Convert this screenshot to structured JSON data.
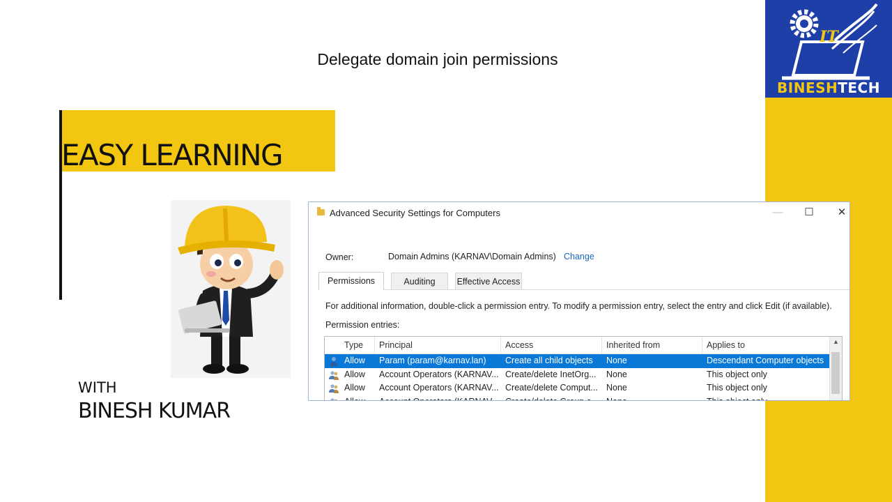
{
  "page_title": "Delegate domain join permissions",
  "banner_text": "EASY LEARNING",
  "with_label": "WITH",
  "author": "BINESH KUMAR",
  "logo": {
    "badge": "IT",
    "part1": "BINESH",
    "part2": "TECH"
  },
  "colors": {
    "accent_yellow": "#f2c611",
    "logo_blue": "#1f3fa8",
    "selection_blue": "#0a78d7",
    "link_blue": "#1a63c6"
  },
  "dialog": {
    "title": "Advanced Security Settings for Computers",
    "window_buttons": {
      "minimize": "—",
      "maximize": "☐",
      "close": "✕"
    },
    "owner_label": "Owner:",
    "owner_value": "Domain Admins (KARNAV\\Domain Admins)",
    "owner_change": "Change",
    "tabs": [
      {
        "label": "Permissions",
        "active": true
      },
      {
        "label": "Auditing",
        "active": false
      },
      {
        "label": "Effective Access",
        "active": false
      }
    ],
    "info_text": "For additional information, double-click a permission entry. To modify a permission entry, select the entry and click Edit (if available).",
    "entries_label": "Permission entries:",
    "columns": [
      "Type",
      "Principal",
      "Access",
      "Inherited from",
      "Applies to"
    ],
    "rows": [
      {
        "icon": "user-icon",
        "type": "Allow",
        "principal": "Param (param@karnav.lan)",
        "access": "Create all child objects",
        "inherited": "None",
        "applies": "Descendant Computer objects",
        "selected": true
      },
      {
        "icon": "group-icon",
        "type": "Allow",
        "principal": "Account Operators (KARNAV...",
        "access": "Create/delete InetOrg...",
        "inherited": "None",
        "applies": "This object only",
        "selected": false
      },
      {
        "icon": "group-icon",
        "type": "Allow",
        "principal": "Account Operators (KARNAV...",
        "access": "Create/delete Comput...",
        "inherited": "None",
        "applies": "This object only",
        "selected": false
      },
      {
        "icon": "group-icon",
        "type": "Allow",
        "principal": "Account Operators (KARNAV...",
        "access": "Create/delete Group o...",
        "inherited": "None",
        "applies": "This object only",
        "selected": false
      }
    ]
  }
}
